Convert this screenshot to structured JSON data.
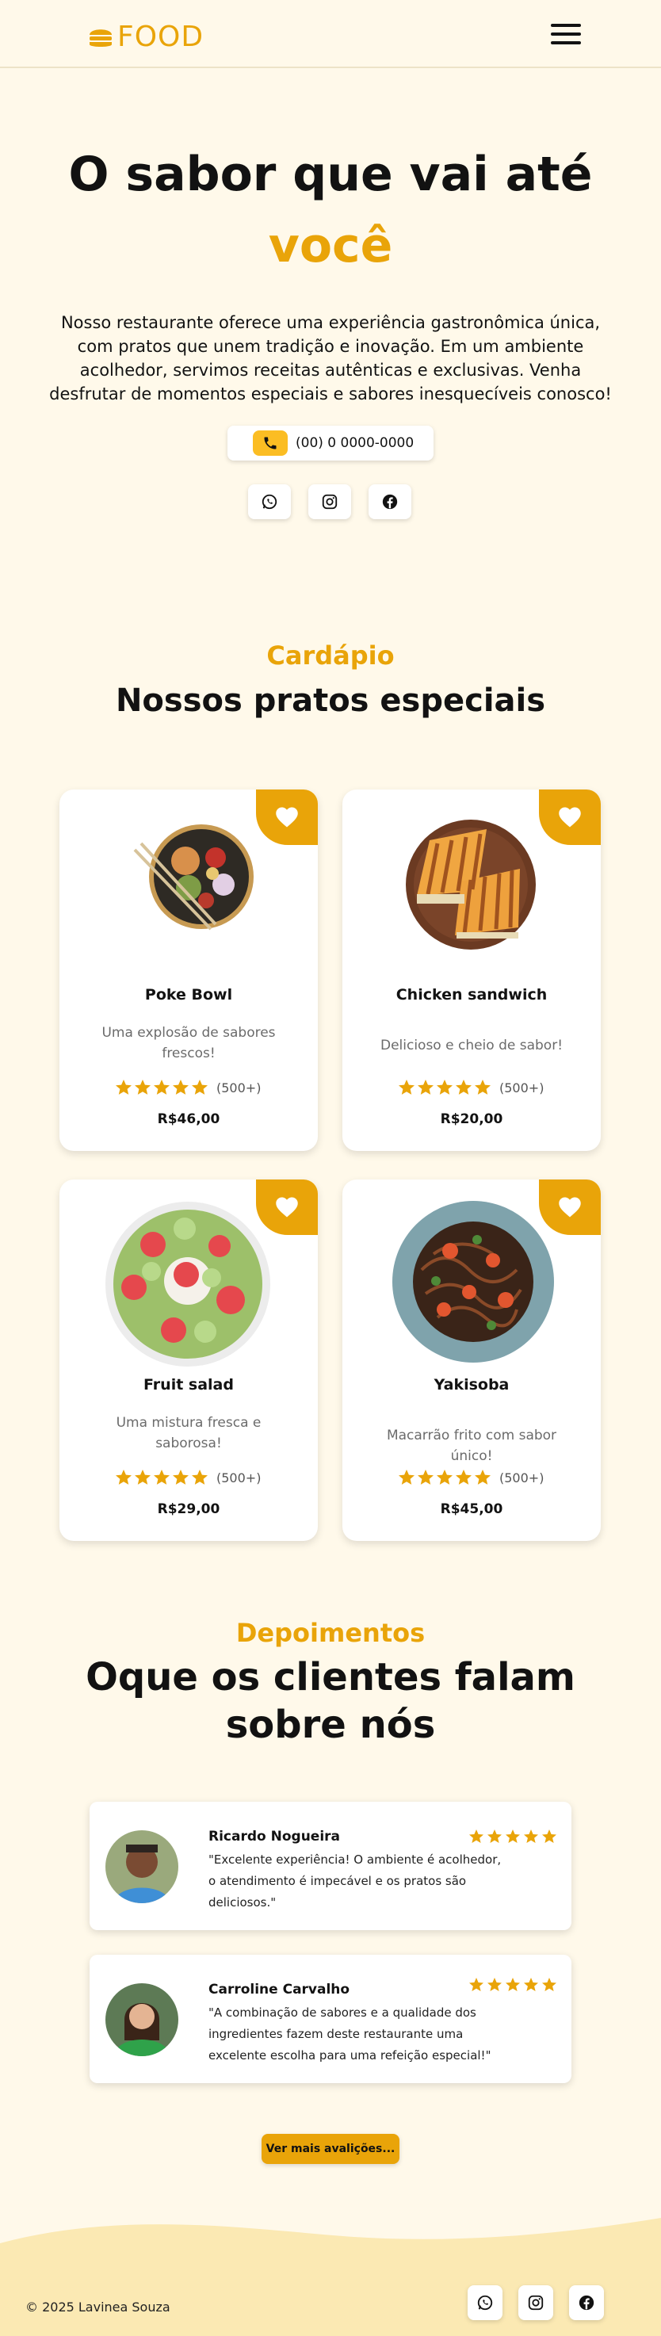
{
  "header": {
    "logo_text": "FOOD",
    "menu_icon": "hamburger-menu-icon"
  },
  "hero": {
    "title_line1": "O sabor que vai até",
    "title_line2": "você",
    "description": "Nosso restaurante oferece uma experiência gastronômica única, com pratos que unem tradição e inovação. Em um ambiente acolhedor, servimos receitas autênticas e exclusivas. Venha desfrutar de momentos especiais e sabores inesquecíveis conosco!",
    "phone": "(00) 0 0000-0000",
    "social": [
      "whatsapp-icon",
      "instagram-icon",
      "facebook-icon"
    ]
  },
  "menu": {
    "subtitle": "Cardápio",
    "title": "Nossos pratos especiais",
    "items": [
      {
        "name": "Poke Bowl",
        "desc": "Uma explosão de sabores frescos!",
        "rating_count": "(500+)",
        "price": "R$46,00",
        "stars": 5
      },
      {
        "name": "Chicken sandwich",
        "desc": "Delicioso e cheio de sabor!",
        "rating_count": "(500+)",
        "price": "R$20,00",
        "stars": 5
      },
      {
        "name": "Fruit salad",
        "desc": "Uma mistura fresca e saborosa!",
        "rating_count": "(500+)",
        "price": "R$29,00",
        "stars": 5
      },
      {
        "name": "Yakisoba",
        "desc": "Macarrão frito com sabor único!",
        "rating_count": "(500+)",
        "price": "R$45,00",
        "stars": 5
      }
    ]
  },
  "testimonials": {
    "subtitle": "Depoimentos",
    "title_line1": "Oque os clientes falam",
    "title_line2": "sobre nós",
    "items": [
      {
        "name": "Ricardo Nogueira",
        "text": "\"Excelente experiência! O ambiente é acolhedor, o atendimento é impecável e os pratos são deliciosos.\"",
        "stars": 5
      },
      {
        "name": "Carroline Carvalho",
        "text": "\"A combinação de sabores e a qualidade dos ingredientes fazem deste restaurante uma excelente escolha para uma refeição especial!\"",
        "stars": 5
      }
    ],
    "more_button": "Ver mais avalições..."
  },
  "footer": {
    "copyright": "© 2025 Lavinea Souza"
  },
  "colors": {
    "accent": "#e9a409",
    "background": "#fff9ea",
    "text": "#121212"
  }
}
